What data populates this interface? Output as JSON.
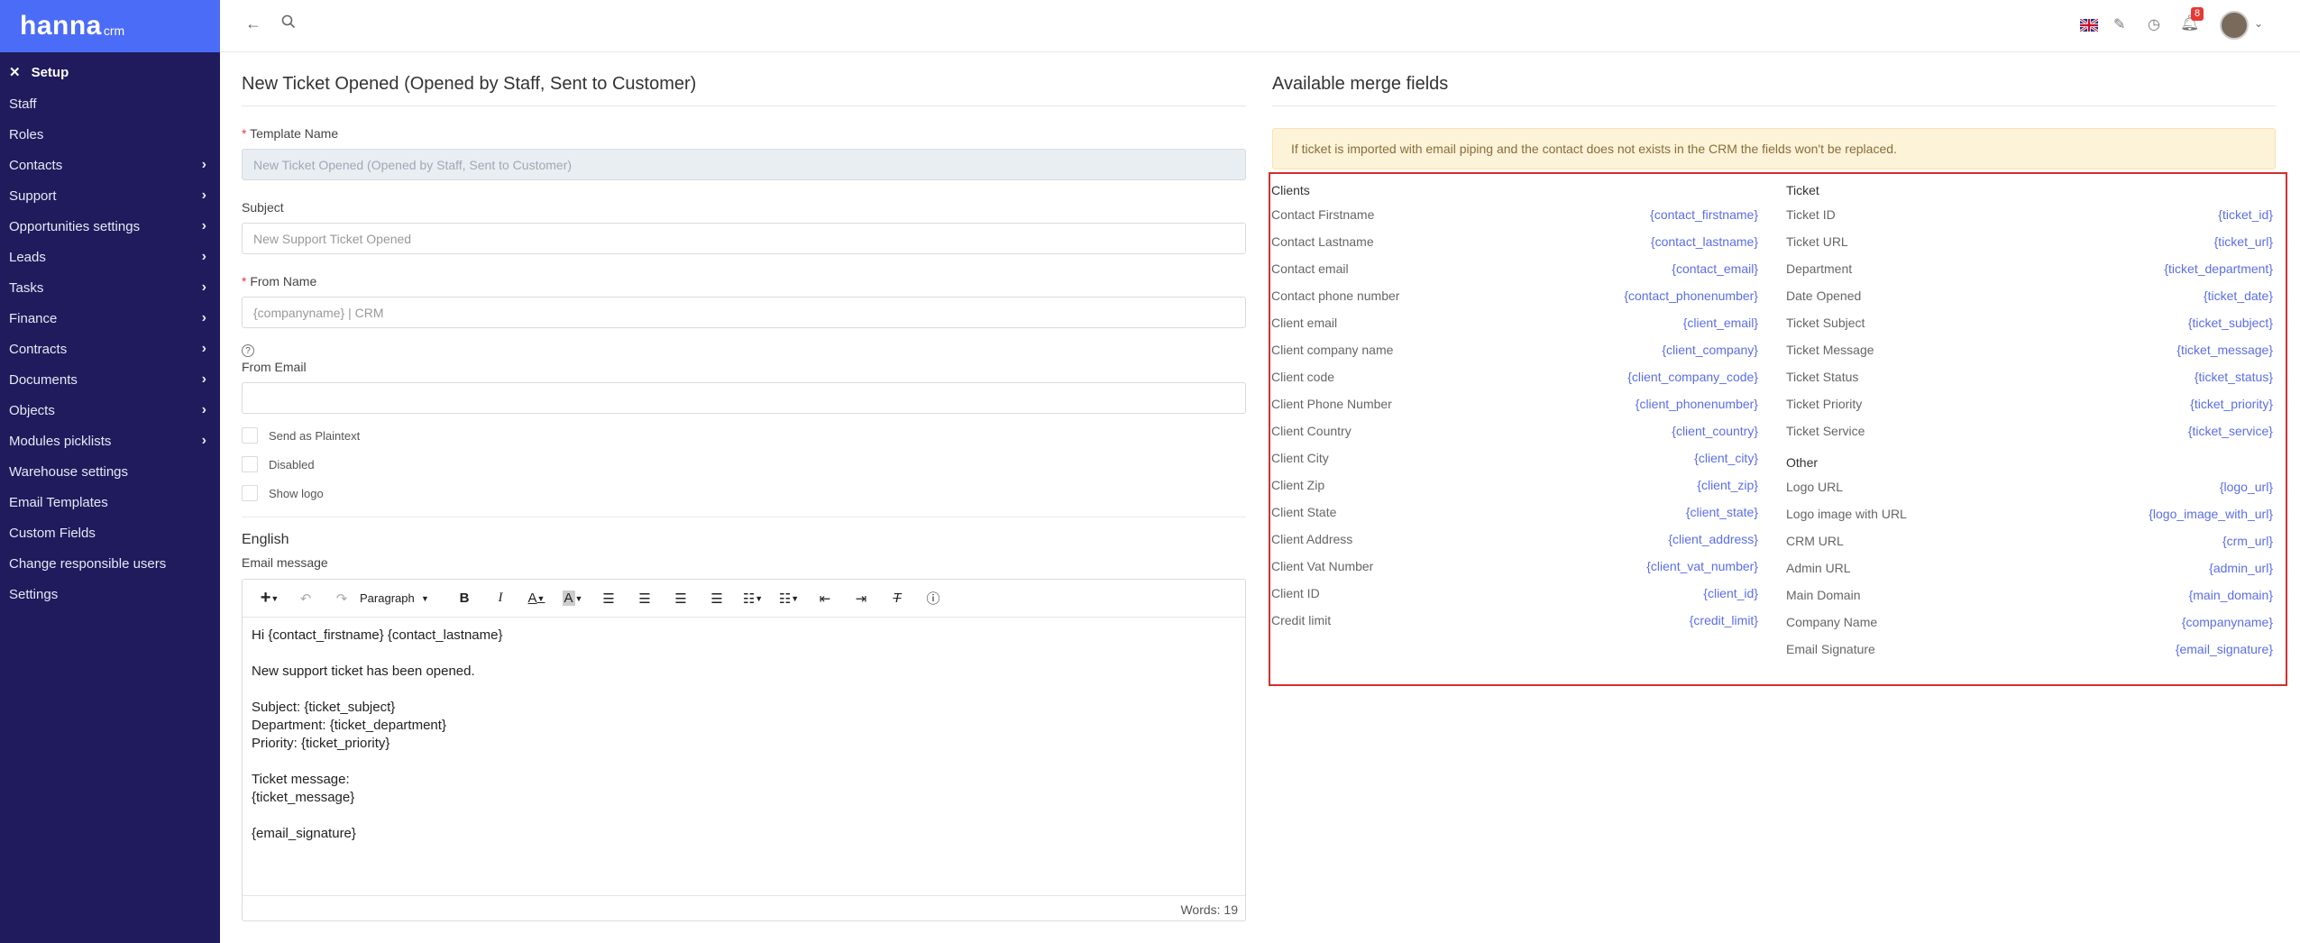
{
  "brand": {
    "logo": "hanna",
    "sub": "crm"
  },
  "sidebar": {
    "setup_label": "Setup",
    "items": [
      {
        "label": "Staff",
        "has_children": false
      },
      {
        "label": "Roles",
        "has_children": false
      },
      {
        "label": "Contacts",
        "has_children": true
      },
      {
        "label": "Support",
        "has_children": true
      },
      {
        "label": "Opportunities settings",
        "has_children": true
      },
      {
        "label": "Leads",
        "has_children": true
      },
      {
        "label": "Tasks",
        "has_children": true
      },
      {
        "label": "Finance",
        "has_children": true
      },
      {
        "label": "Contracts",
        "has_children": true
      },
      {
        "label": "Documents",
        "has_children": true
      },
      {
        "label": "Objects",
        "has_children": true
      },
      {
        "label": "Modules picklists",
        "has_children": true
      },
      {
        "label": "Warehouse settings",
        "has_children": false
      },
      {
        "label": "Email Templates",
        "has_children": false
      },
      {
        "label": "Custom Fields",
        "has_children": false
      },
      {
        "label": "Change responsible users",
        "has_children": false
      },
      {
        "label": "Settings",
        "has_children": false
      }
    ]
  },
  "topbar": {
    "notification_count": "8"
  },
  "form": {
    "title": "New Ticket Opened (Opened by Staff, Sent to Customer)",
    "template_name_label": "Template Name",
    "template_name_value": "New Ticket Opened (Opened by Staff, Sent to Customer)",
    "subject_label": "Subject",
    "subject_value": "New Support Ticket Opened",
    "from_name_label": "From Name",
    "from_name_value": "{companyname} | CRM",
    "from_email_label": "From Email",
    "from_email_value": "",
    "checkboxes": [
      {
        "label": "Send as Plaintext"
      },
      {
        "label": "Disabled"
      },
      {
        "label": "Show logo"
      }
    ],
    "language": "English",
    "email_message_label": "Email message",
    "editor_block_format": "Paragraph",
    "editor_lines": [
      "Hi {contact_firstname} {contact_lastname}",
      "",
      "New support ticket has been opened.",
      "",
      "Subject: {ticket_subject}",
      "Department: {ticket_department}",
      "Priority: {ticket_priority}",
      "",
      "Ticket message:",
      "{ticket_message}",
      "",
      "{email_signature}"
    ],
    "word_count": "Words: 19"
  },
  "merge": {
    "title": "Available merge fields",
    "alert": "If ticket is imported with email piping and the contact does not exists in the CRM the fields won't be replaced.",
    "clients_title": "Clients",
    "clients": [
      {
        "name": "Contact Firstname",
        "key": "{contact_firstname}"
      },
      {
        "name": "Contact Lastname",
        "key": "{contact_lastname}"
      },
      {
        "name": "Contact email",
        "key": "{contact_email}"
      },
      {
        "name": "Contact phone number",
        "key": "{contact_phonenumber}"
      },
      {
        "name": "Client email",
        "key": "{client_email}"
      },
      {
        "name": "Client company name",
        "key": "{client_company}"
      },
      {
        "name": "Client code",
        "key": "{client_company_code}"
      },
      {
        "name": "Client Phone Number",
        "key": "{client_phonenumber}"
      },
      {
        "name": "Client Country",
        "key": "{client_country}"
      },
      {
        "name": "Client City",
        "key": "{client_city}"
      },
      {
        "name": "Client Zip",
        "key": "{client_zip}"
      },
      {
        "name": "Client State",
        "key": "{client_state}"
      },
      {
        "name": "Client Address",
        "key": "{client_address}"
      },
      {
        "name": "Client Vat Number",
        "key": "{client_vat_number}"
      },
      {
        "name": "Client ID",
        "key": "{client_id}"
      },
      {
        "name": "Credit limit",
        "key": "{credit_limit}"
      }
    ],
    "ticket_title": "Ticket",
    "ticket": [
      {
        "name": "Ticket ID",
        "key": "{ticket_id}"
      },
      {
        "name": "Ticket URL",
        "key": "{ticket_url}"
      },
      {
        "name": "Department",
        "key": "{ticket_department}"
      },
      {
        "name": "Date Opened",
        "key": "{ticket_date}"
      },
      {
        "name": "Ticket Subject",
        "key": "{ticket_subject}"
      },
      {
        "name": "Ticket Message",
        "key": "{ticket_message}"
      },
      {
        "name": "Ticket Status",
        "key": "{ticket_status}"
      },
      {
        "name": "Ticket Priority",
        "key": "{ticket_priority}"
      },
      {
        "name": "Ticket Service",
        "key": "{ticket_service}"
      }
    ],
    "other_title": "Other",
    "other": [
      {
        "name": "Logo URL",
        "key": "{logo_url}"
      },
      {
        "name": "Logo image with URL",
        "key": "{logo_image_with_url}"
      },
      {
        "name": "CRM URL",
        "key": "{crm_url}"
      },
      {
        "name": "Admin URL",
        "key": "{admin_url}"
      },
      {
        "name": "Main Domain",
        "key": "{main_domain}"
      },
      {
        "name": "Company Name",
        "key": "{companyname}"
      },
      {
        "name": "Email Signature",
        "key": "{email_signature}"
      }
    ]
  },
  "colors": {
    "sidebar_bg": "#1f1b5c",
    "brand_bg": "#4b6cf7",
    "merge_key": "#5b6ee8",
    "highlight_border": "#d32f2f",
    "alert_bg": "#fcf3d8"
  }
}
